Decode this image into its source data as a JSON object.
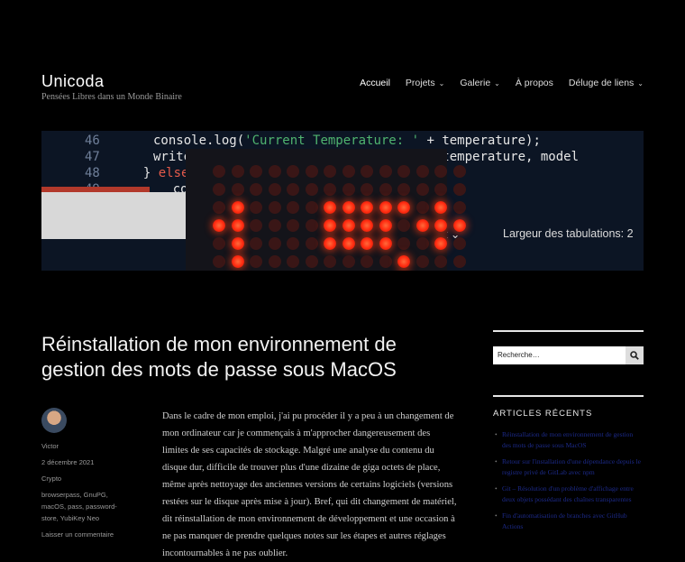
{
  "site": {
    "title": "Unicoda",
    "description": "Pensées Libres dans un Monde Binaire"
  },
  "nav": [
    {
      "label": "Accueil",
      "has_sub": false,
      "active": true
    },
    {
      "label": "Projets",
      "has_sub": true
    },
    {
      "label": "Galerie",
      "has_sub": true
    },
    {
      "label": "À propos",
      "has_sub": false
    },
    {
      "label": "Déluge de liens",
      "has_sub": true
    }
  ],
  "hero": {
    "lines": [
      {
        "num": "46",
        "parts": [
          [
            "console.log(",
            ""
          ],
          [
            "'Current Temperature: '",
            "str"
          ],
          [
            " + temperature);",
            ""
          ]
        ]
      },
      {
        "num": "47",
        "parts": [
          [
            "write",
            ""
          ],
          [
            "                         ",
            ""
          ],
          [
            "layTemp(temperature, model",
            ""
          ]
        ]
      },
      {
        "num": "48",
        "parts": [
          [
            "  } ",
            ""
          ],
          [
            "else",
            "kw"
          ]
        ]
      },
      {
        "num": "49",
        "parts": [
          [
            "    cons",
            ""
          ]
        ]
      }
    ],
    "status_left": "pt ⌄",
    "status_right": "Largeur des tabulations: 2"
  },
  "post": {
    "title": "Réinstallation de mon environnement de gestion des mots de passe sous MacOS",
    "author": "Victor",
    "date": "2 décembre 2021",
    "category": "Crypto",
    "tags": "browserpass, GnuPG, macOS, pass, password-store, YubiKey Neo",
    "comment_link": "Laisser un commentaire",
    "body": "Dans le cadre de mon emploi, j'ai pu procéder il y a peu à un changement de mon ordinateur car je commençais à m'approcher dangereusement des limites de ses capacités de stockage. Malgré une analyse du contenu du disque dur, difficile de trouver plus d'une dizaine de giga octets de place, même après nettoyage des anciennes versions de certains logiciels (versions restées sur le disque après mise à jour). Bref, qui dit changement de matériel, dit réinstallation de mon environnement de développement et une occasion à ne pas manquer de prendre quelques notes sur les étapes et autres réglages incontournables à ne pas oublier."
  },
  "sidebar": {
    "search_placeholder": "Recherche…",
    "recent_title": "ARTICLES RÉCENTS",
    "recent": [
      "Réinstallation de mon environnement de gestion des mots de passe sous MacOS",
      "Retour sur l'installation d'une dépendance depuis le registre privé de GitLab avec npm",
      "Git – Résolution d'un problème d'affichage entre deux objets possédant des chaînes transparentes",
      "Fin d'automatisation de branches avec GitHub Actions"
    ]
  },
  "colors": {
    "background": "#000000",
    "led": "#ff2a10",
    "link": "#1c2a8a"
  }
}
